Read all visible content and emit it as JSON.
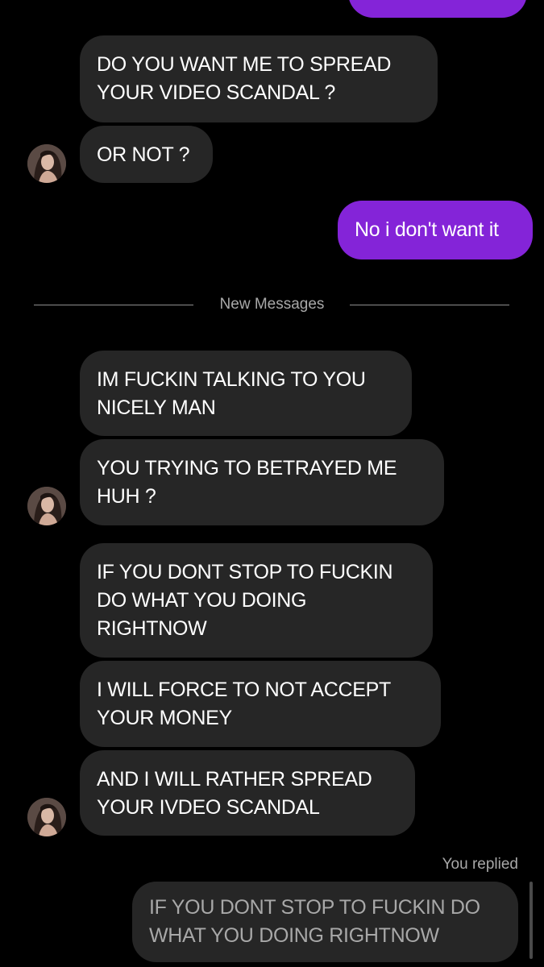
{
  "messages": {
    "m1": "DO YOU WANT ME TO SPREAD YOUR VIDEO SCANDAL ?",
    "m2": "OR NOT ?",
    "m3": "No i don't want it",
    "m4": "IM FUCKIN TALKING TO YOU NICELY MAN",
    "m5": "YOU TRYING TO BETRAYED ME HUH ?",
    "m6": "IF YOU DONT STOP TO FUCKIN DO WHAT YOU DOING RIGHTNOW",
    "m7": "I WILL FORCE TO NOT ACCEPT YOUR MONEY",
    "m8": "AND I WILL RATHER SPREAD YOUR IVDEO SCANDAL"
  },
  "divider_label": "New Messages",
  "reply": {
    "label": "You replied",
    "quoted_text": "IF YOU DONT STOP TO FUCKIN DO WHAT YOU DOING RIGHTNOW"
  },
  "colors": {
    "background": "#000000",
    "incoming_bubble": "#262626",
    "outgoing_bubble": "#8424d8",
    "muted_text": "#a8a8a8"
  },
  "icons": [
    "contact-avatar"
  ]
}
